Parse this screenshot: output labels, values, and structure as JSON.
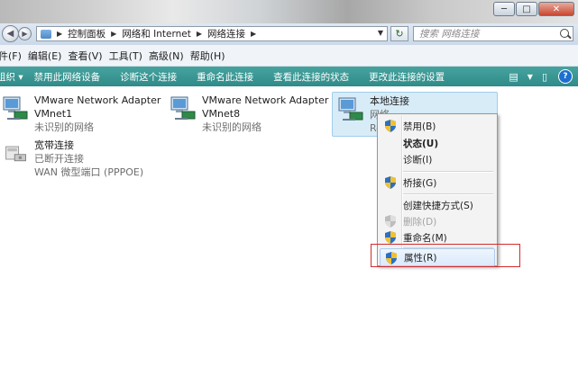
{
  "window": {
    "minimize": "─",
    "maximize": "□",
    "close": "✕"
  },
  "address": {
    "crumbs": [
      "控制面板",
      "网络和 Internet",
      "网络连接"
    ],
    "search_placeholder": "搜索 网络连接"
  },
  "menu": {
    "items": [
      "件(F)",
      "编辑(E)",
      "查看(V)",
      "工具(T)",
      "高级(N)",
      "帮助(H)"
    ]
  },
  "commands": {
    "items": [
      "组织 ▾",
      "禁用此网络设备",
      "诊断这个连接",
      "重命名此连接",
      "查看此连接的状态",
      "更改此连接的设置"
    ]
  },
  "connections": [
    {
      "name": "VMware Network Adapter",
      "line2": "VMnet1",
      "status": "未识别的网络"
    },
    {
      "name": "VMware Network Adapter",
      "line2": "VMnet8",
      "status": "未识别的网络"
    },
    {
      "name": "本地连接",
      "line2": "网络",
      "status": "Re"
    },
    {
      "name": "宽带连接",
      "line2": "已断开连接",
      "status": "WAN 微型端口 (PPPOE)"
    }
  ],
  "context_menu": {
    "items": [
      {
        "label": "禁用(B)",
        "icon": "shield-icon"
      },
      {
        "label": "状态(U)",
        "icon": ""
      },
      {
        "label": "诊断(I)",
        "icon": ""
      },
      {
        "label": "桥接(G)",
        "icon": "shield-icon"
      },
      {
        "label": "创建快捷方式(S)",
        "icon": ""
      },
      {
        "label": "删除(D)",
        "icon": "shield-icon"
      },
      {
        "label": "重命名(M)",
        "icon": "shield-icon"
      },
      {
        "label": "属性(R)",
        "icon": "shield-icon"
      }
    ]
  },
  "colors": {
    "command_bar": "#3a9894",
    "highlight_box": "#d52b2b",
    "selection": "#d8ecf8"
  }
}
